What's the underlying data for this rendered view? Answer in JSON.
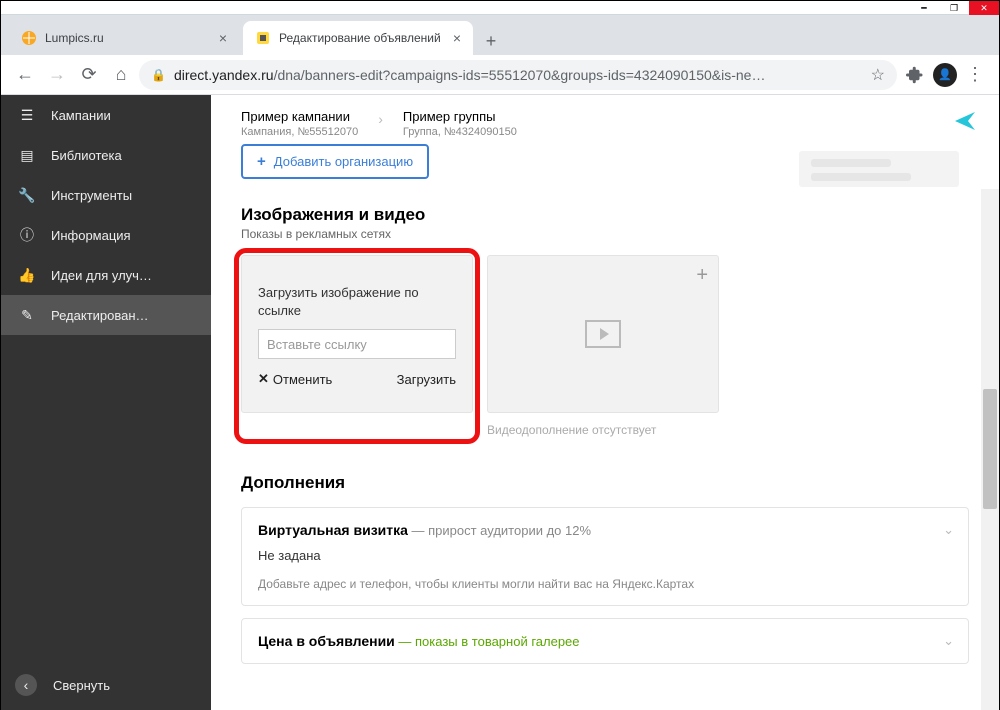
{
  "browser": {
    "tabs": [
      {
        "title": "Lumpics.ru"
      },
      {
        "title": "Редактирование объявлений"
      }
    ],
    "url_domain": "direct.yandex.ru",
    "url_path": "/dna/banners-edit?campaigns-ids=55512070&groups-ids=4324090150&is-ne…"
  },
  "sidebar": {
    "items": [
      {
        "label": "Кампании"
      },
      {
        "label": "Библиотека"
      },
      {
        "label": "Инструменты"
      },
      {
        "label": "Информация"
      },
      {
        "label": "Идеи для улуч…"
      },
      {
        "label": "Редактирован…"
      }
    ],
    "collapse_label": "Свернуть"
  },
  "breadcrumbs": {
    "campaign_title": "Пример кампании",
    "campaign_sub": "Кампания, №55512070",
    "group_title": "Пример группы",
    "group_sub": "Группа, №4324090150"
  },
  "buttons": {
    "add_org": "Добавить организацию"
  },
  "sections": {
    "media_title": "Изображения и видео",
    "media_sub": "Показы в рекламных сетях",
    "addons_title": "Дополнения"
  },
  "image_card": {
    "title": "Загрузить изображение по ссылке",
    "placeholder": "Вставьте ссылку",
    "cancel": "Отменить",
    "upload": "Загрузить"
  },
  "video_card": {
    "note": "Видеодополнение отсутствует"
  },
  "addons": [
    {
      "title": "Виртуальная визитка",
      "note": " — прирост аудитории до 12%",
      "note_class": "",
      "sub": "Не задана",
      "help": "Добавьте адрес и телефон, чтобы клиенты могли найти вас на Яндекс.Картах"
    },
    {
      "title": "Цена в объявлении",
      "note": " — показы в товарной галерее",
      "note_class": "green",
      "sub": "",
      "help": ""
    }
  ]
}
